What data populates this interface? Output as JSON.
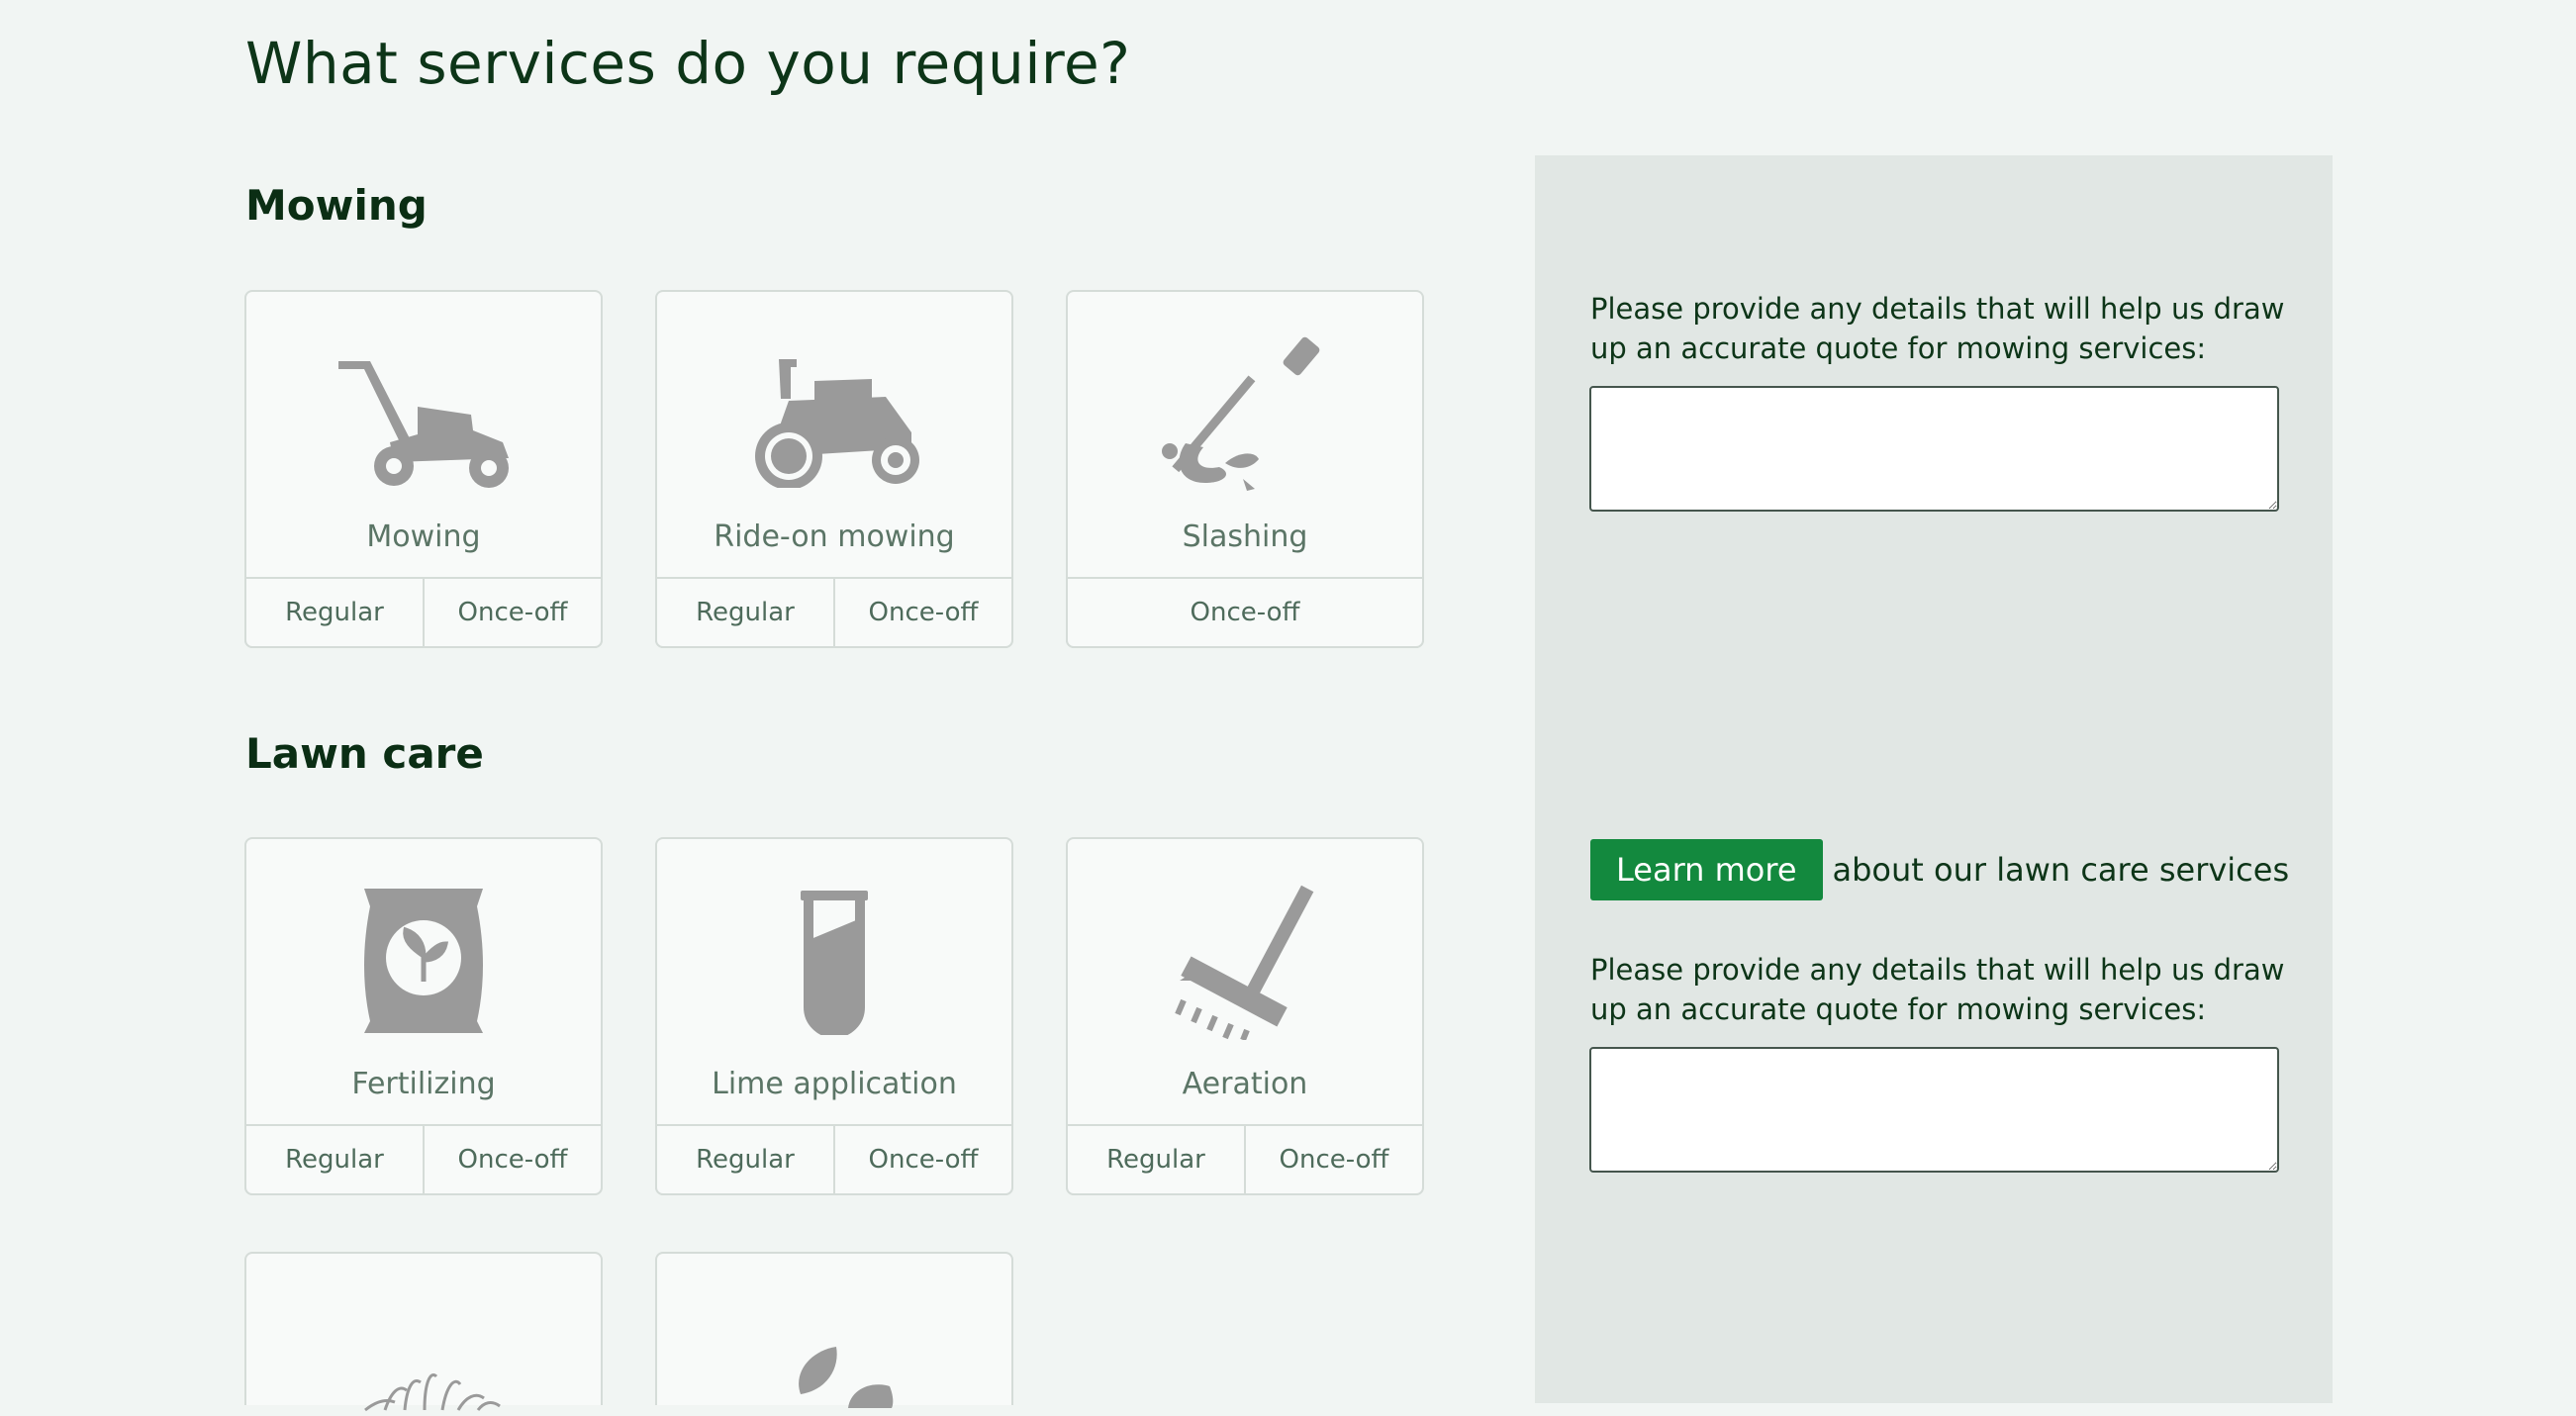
{
  "page": {
    "title": "What services do you require?"
  },
  "sections": {
    "mowing": {
      "title": "Mowing"
    },
    "lawn_care": {
      "title": "Lawn care"
    }
  },
  "cards": {
    "mowing": {
      "label": "Mowing",
      "icon": "push-mower-icon"
    },
    "ride_on": {
      "label": "Ride-on mowing",
      "icon": "ride-on-mower-icon"
    },
    "slashing": {
      "label": "Slashing",
      "icon": "line-trimmer-icon"
    },
    "fertilizing": {
      "label": "Fertilizing",
      "icon": "fertilizer-bag-icon"
    },
    "lime": {
      "label": "Lime application",
      "icon": "test-tube-icon"
    },
    "aeration": {
      "label": "Aeration",
      "icon": "aerator-icon"
    }
  },
  "actions": {
    "regular": "Regular",
    "once_off": "Once-off"
  },
  "panel": {
    "mowing_prompt": "Please provide any details that will help us draw up an accurate quote for mowing services:",
    "learn_more": "Learn more",
    "learn_more_tail": "about our lawn care services",
    "lawn_prompt": "Please provide any details that will help us draw up an accurate quote for mowing services:"
  },
  "colors": {
    "background": "#f1f5f3",
    "panel": "#e1e7e4",
    "accent": "#13893e",
    "icon": "#9a9a9a",
    "heading": "#0d3518"
  }
}
